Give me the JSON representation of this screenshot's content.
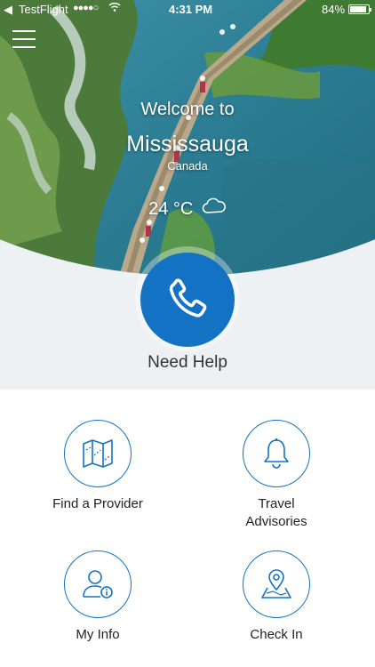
{
  "status_bar": {
    "back_app": "TestFlight",
    "signal": "●●●●○",
    "time": "4:31 PM",
    "battery": "84%",
    "battery_level": 0.84
  },
  "header": {
    "welcome": "Welcome to",
    "city": "Mississauga",
    "country": "Canada",
    "temperature": "24 °C",
    "weather_icon": "cloud-icon"
  },
  "help": {
    "label": "Need Help",
    "icon": "phone-icon"
  },
  "tiles": [
    {
      "label": "Find a Provider",
      "icon": "map-icon"
    },
    {
      "label": "Travel\nAdvisories",
      "icon": "bell-icon"
    },
    {
      "label": "My Info",
      "icon": "user-info-icon"
    },
    {
      "label": "Check In",
      "icon": "location-pin-icon"
    }
  ],
  "colors": {
    "accent": "#1472c5",
    "upper_background": "#edf1f3",
    "background": "#ffffff"
  }
}
